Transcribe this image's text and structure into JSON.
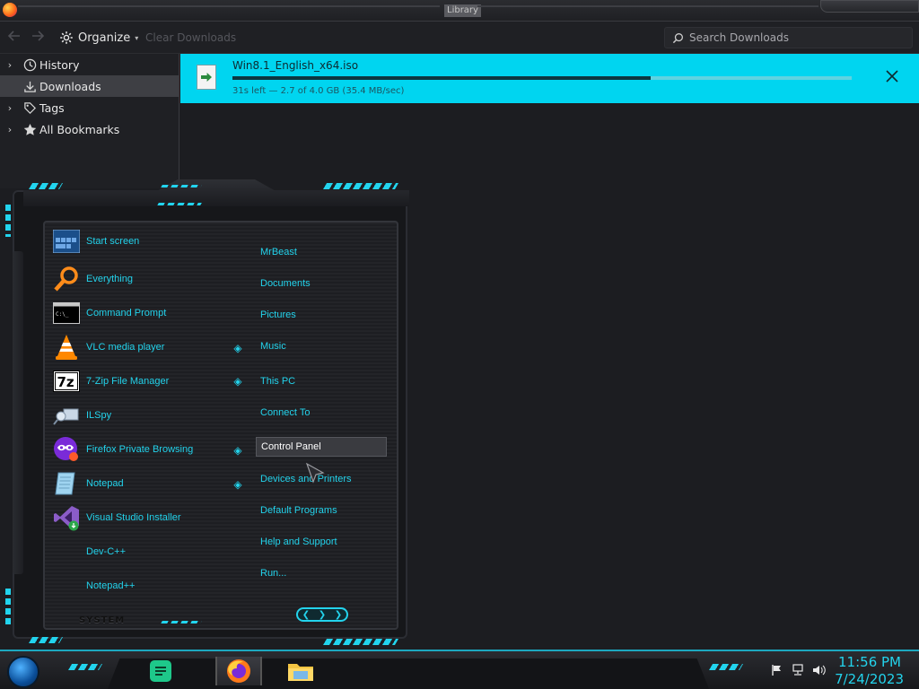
{
  "window": {
    "title": "Library"
  },
  "toolbar": {
    "back_icon": "arrow-left-icon",
    "forward_icon": "arrow-right-icon",
    "organize_label": "Organize",
    "clear_downloads_label": "Clear Downloads",
    "search_placeholder": "Search Downloads"
  },
  "sidebar": {
    "items": [
      {
        "label": "History",
        "icon": "clock-icon",
        "expandable": true,
        "selected": false
      },
      {
        "label": "Downloads",
        "icon": "download-icon",
        "expandable": false,
        "selected": true
      },
      {
        "label": "Tags",
        "icon": "tag-icon",
        "expandable": true,
        "selected": false
      },
      {
        "label": "All Bookmarks",
        "icon": "star-icon",
        "expandable": true,
        "selected": false
      }
    ]
  },
  "downloads": {
    "items": [
      {
        "filename": "Win8.1_English_x64.iso",
        "status": "31s left — 2.7 of 4.0 GB (35.4 MB/sec)",
        "progress": 0.675
      }
    ]
  },
  "start_menu": {
    "apps": [
      {
        "label": "Start screen",
        "icon": "start-screen-icon",
        "has_submenu": false
      },
      {
        "label": "Everything",
        "icon": "everything-search-icon",
        "has_submenu": false
      },
      {
        "label": "Command Prompt",
        "icon": "command-prompt-icon",
        "has_submenu": false
      },
      {
        "label": "VLC media player",
        "icon": "vlc-icon",
        "has_submenu": true
      },
      {
        "label": "7-Zip File Manager",
        "icon": "7zip-icon",
        "has_submenu": true
      },
      {
        "label": "ILSpy",
        "icon": "ilspy-icon",
        "has_submenu": false
      },
      {
        "label": "Firefox Private Browsing",
        "icon": "firefox-private-icon",
        "has_submenu": true
      },
      {
        "label": "Notepad",
        "icon": "notepad-icon",
        "has_submenu": true
      },
      {
        "label": "Visual Studio Installer",
        "icon": "visual-studio-installer-icon",
        "has_submenu": false
      },
      {
        "label": "Dev-C++",
        "icon": "",
        "has_submenu": false
      },
      {
        "label": "Notepad++",
        "icon": "",
        "has_submenu": false
      }
    ],
    "places": [
      {
        "label": "MrBeast"
      },
      {
        "label": "Documents"
      },
      {
        "label": "Pictures"
      },
      {
        "label": "Music"
      },
      {
        "label": "This PC"
      },
      {
        "label": "Connect To"
      },
      {
        "label": "Control Panel",
        "hovered": true
      },
      {
        "label": "Devices and Printers"
      },
      {
        "label": "Default Programs"
      },
      {
        "label": "Help and Support"
      },
      {
        "label": "Run..."
      }
    ],
    "footer_label": "SYSTEM"
  },
  "taskbar": {
    "pinned": [
      {
        "name": "sticky-notes-icon",
        "active": false
      },
      {
        "name": "firefox-icon",
        "active": true
      },
      {
        "name": "file-explorer-icon",
        "active": false
      }
    ],
    "tray": [
      "flag-icon",
      "network-icon",
      "volume-icon"
    ],
    "time": "11:56 PM",
    "date": "7/24/2023"
  },
  "colors": {
    "accent": "#23d3ec",
    "download_highlight": "#00d5f0",
    "background": "#1c1d21"
  }
}
